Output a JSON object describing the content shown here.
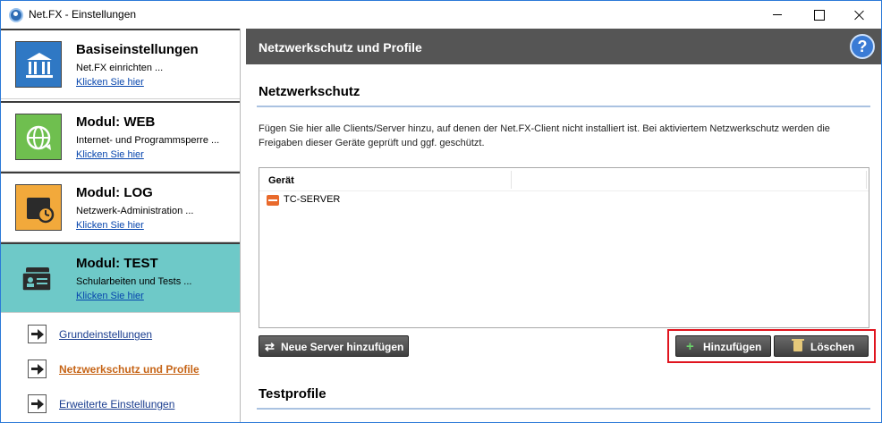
{
  "window": {
    "title": "Net.FX - Einstellungen"
  },
  "sidebar": {
    "modules": [
      {
        "title": "Basiseinstellungen",
        "desc": "Net.FX einrichten ...",
        "link": "Klicken Sie hier"
      },
      {
        "title": "Modul: WEB",
        "desc": "Internet- und Programmsperre ...",
        "link": "Klicken Sie hier"
      },
      {
        "title": "Modul: LOG",
        "desc": "Netzwerk-Administration ...",
        "link": "Klicken Sie hier"
      },
      {
        "title": "Modul: TEST",
        "desc": "Schularbeiten und Tests ...",
        "link": "Klicken Sie hier"
      }
    ],
    "subnav": [
      {
        "label": "Grundeinstellungen"
      },
      {
        "label": "Netzwerkschutz und Profile"
      },
      {
        "label": "Erweiterte Einstellungen"
      }
    ]
  },
  "main": {
    "header_title": "Netzwerkschutz und Profile",
    "help_label": "?",
    "section1_title": "Netzwerkschutz",
    "description": "Fügen Sie hier alle Clients/Server hinzu, auf denen der Net.FX-Client nicht installiert ist. Bei aktiviertem Netzwerkschutz werden die Freigaben dieser Geräte geprüft und ggf. geschützt.",
    "list": {
      "column_header": "Gerät",
      "rows": [
        {
          "name": "TC-SERVER"
        }
      ]
    },
    "buttons": {
      "new_server": "Neue Server hinzufügen",
      "add": "Hinzufügen",
      "delete": "Löschen"
    },
    "section2_title": "Testprofile"
  },
  "colors": {
    "active_module": "#6ec9c8",
    "header_bg": "#555555",
    "highlight": "#e0141e",
    "current_subnav": "#c66416"
  }
}
